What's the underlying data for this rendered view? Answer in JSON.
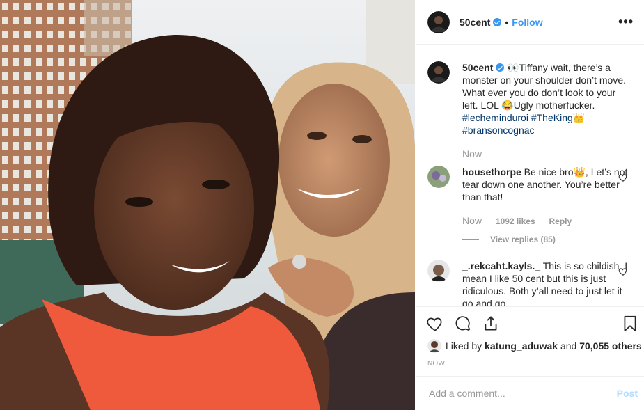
{
  "post": {
    "username": "50cent",
    "follow_separator": "•",
    "follow_label": "Follow",
    "more_label": "•••"
  },
  "caption": {
    "username": "50cent",
    "text": "👀Tiffany wait, there’s a monster on your shoulder don’t move. What ever you do don’t look to your left. LOL 😂Ugly motherfucker.",
    "hashtags": [
      "#lecheminduroi",
      "#TheKing👑",
      "#bransoncognac"
    ],
    "time": "Now"
  },
  "comments": [
    {
      "username": "housethorpe",
      "text": "Be nice bro👑, Let’s not tear down one another. You’re better than that!",
      "time": "Now",
      "likes": "1092 likes",
      "reply_label": "Reply",
      "view_replies": "View replies (85)"
    },
    {
      "username": "_.rekcaht.kayls._",
      "text": "This is so childish. I mean I like 50 cent but this is just ridiculous. Both y’all need to just let it go and go"
    }
  ],
  "likes_bar": {
    "prefix": "Liked by",
    "user": "katung_aduwak",
    "middle": "and",
    "count": "70,055 others"
  },
  "timestamp": "NOW",
  "add_comment": {
    "placeholder": "Add a comment...",
    "post_label": "Post"
  },
  "colors": {
    "link": "#3897f0",
    "hashtag": "#003569",
    "muted": "#999999",
    "border": "#efefef"
  },
  "icons": [
    "heart-icon",
    "comment-icon",
    "share-icon",
    "bookmark-icon",
    "verified-badge-icon",
    "more-icon"
  ]
}
